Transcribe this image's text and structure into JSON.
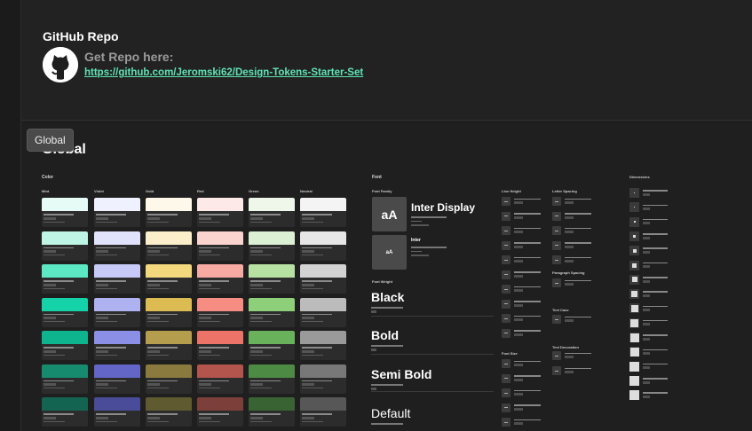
{
  "repo": {
    "title": "GitHub Repo",
    "get_repo": "Get Repo here:",
    "link": "https://github.com/Jeromski62/Design-Tokens-Starter-Set"
  },
  "global": {
    "heading": "Global",
    "tag": "Global"
  },
  "color": {
    "title": "Color",
    "columns": [
      "Mint",
      "Violet",
      "Gold",
      "Red",
      "Green",
      "Neutral"
    ],
    "swatches": [
      [
        "#e6fbf5",
        "#f0f1fe",
        "#fdf8e9",
        "#fde9e7",
        "#eef7ea",
        "#f4f4f4"
      ],
      [
        "#bff5e5",
        "#e1e3fc",
        "#fbeeca",
        "#fbd4cf",
        "#dcf0d3",
        "#e6e6e6"
      ],
      [
        "#5be8c3",
        "#c7caf7",
        "#f3d77c",
        "#f7aaa1",
        "#b6e1a3",
        "#d3d3d3"
      ],
      [
        "#14d3a8",
        "#aeb2f1",
        "#dcbb53",
        "#f58d82",
        "#8ed07a",
        "#bcbcbc"
      ],
      [
        "#0db48e",
        "#8c8fe6",
        "#b49d4d",
        "#ec7368",
        "#69b15a",
        "#9a9a9a"
      ],
      [
        "#168b6e",
        "#6366c7",
        "#8b7a3d",
        "#b3554c",
        "#4d8a44",
        "#787878"
      ],
      [
        "#136551",
        "#4a4c9a",
        "#5f5a30",
        "#7d3f3a",
        "#3a6333",
        "#575757"
      ]
    ]
  },
  "font": {
    "title": "Font",
    "family_title": "Font Family",
    "family_1_glyph": "aA",
    "family_1_name": "Inter Display",
    "family_2_glyph": "aA",
    "family_2_name": "Inter",
    "weight_title": "Font Weight",
    "weights": [
      "Black",
      "Bold",
      "Semi Bold",
      "Default"
    ]
  },
  "line_height": {
    "title": "Line Height"
  },
  "letter_spacing": {
    "title": "Letter Spacing"
  },
  "paragraph_spacing": {
    "title": "Paragraph Spacing"
  },
  "text_case": {
    "title": "Text Case"
  },
  "text_decoration": {
    "title": "Text Decoration"
  },
  "font_size": {
    "title": "Font Size"
  },
  "dimensions": {
    "title": "Dimensions"
  }
}
